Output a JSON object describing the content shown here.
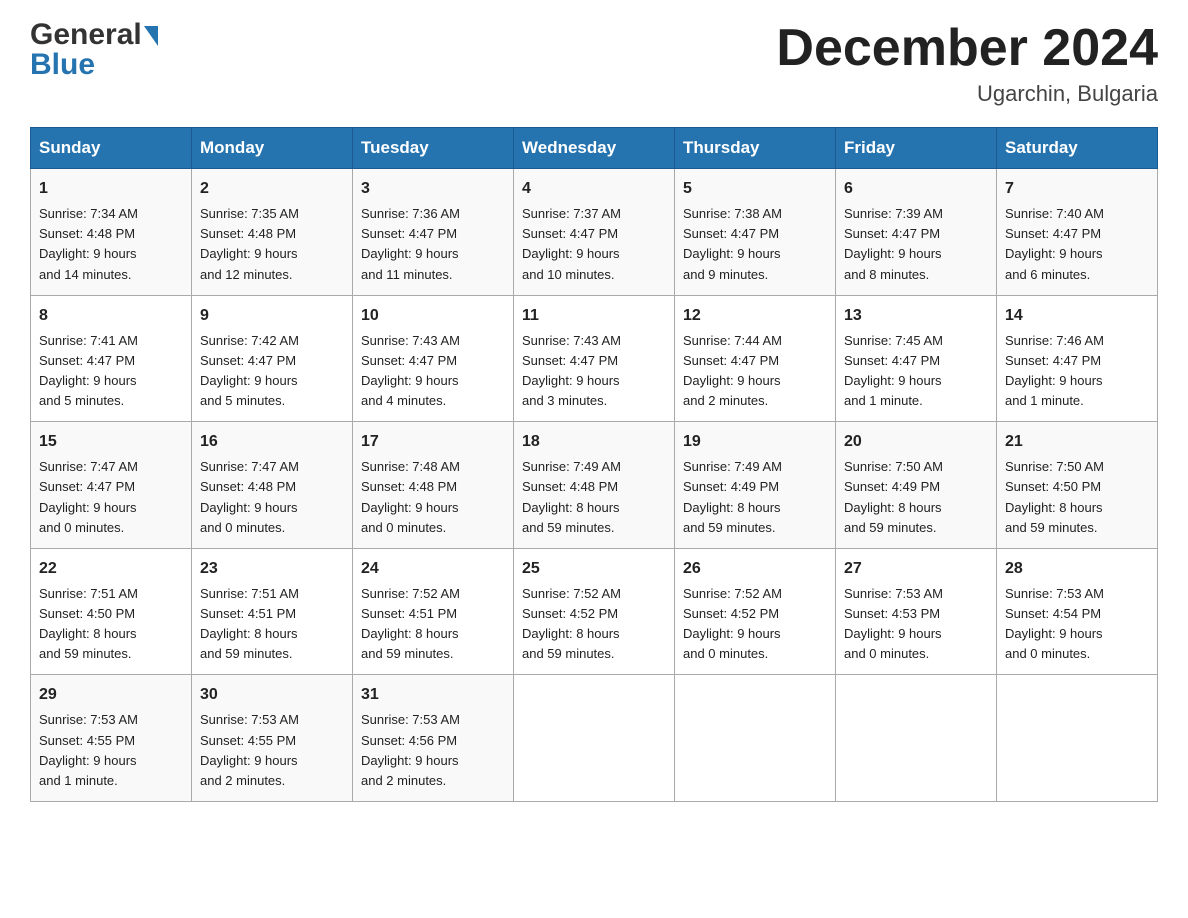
{
  "header": {
    "logo_line1": "General",
    "logo_triangle": "▶",
    "logo_line2": "Blue",
    "month_year": "December 2024",
    "location": "Ugarchin, Bulgaria"
  },
  "columns": [
    "Sunday",
    "Monday",
    "Tuesday",
    "Wednesday",
    "Thursday",
    "Friday",
    "Saturday"
  ],
  "weeks": [
    [
      {
        "day": "1",
        "sunrise": "7:34 AM",
        "sunset": "4:48 PM",
        "daylight": "9 hours and 14 minutes."
      },
      {
        "day": "2",
        "sunrise": "7:35 AM",
        "sunset": "4:48 PM",
        "daylight": "9 hours and 12 minutes."
      },
      {
        "day": "3",
        "sunrise": "7:36 AM",
        "sunset": "4:47 PM",
        "daylight": "9 hours and 11 minutes."
      },
      {
        "day": "4",
        "sunrise": "7:37 AM",
        "sunset": "4:47 PM",
        "daylight": "9 hours and 10 minutes."
      },
      {
        "day": "5",
        "sunrise": "7:38 AM",
        "sunset": "4:47 PM",
        "daylight": "9 hours and 9 minutes."
      },
      {
        "day": "6",
        "sunrise": "7:39 AM",
        "sunset": "4:47 PM",
        "daylight": "9 hours and 8 minutes."
      },
      {
        "day": "7",
        "sunrise": "7:40 AM",
        "sunset": "4:47 PM",
        "daylight": "9 hours and 6 minutes."
      }
    ],
    [
      {
        "day": "8",
        "sunrise": "7:41 AM",
        "sunset": "4:47 PM",
        "daylight": "9 hours and 5 minutes."
      },
      {
        "day": "9",
        "sunrise": "7:42 AM",
        "sunset": "4:47 PM",
        "daylight": "9 hours and 5 minutes."
      },
      {
        "day": "10",
        "sunrise": "7:43 AM",
        "sunset": "4:47 PM",
        "daylight": "9 hours and 4 minutes."
      },
      {
        "day": "11",
        "sunrise": "7:43 AM",
        "sunset": "4:47 PM",
        "daylight": "9 hours and 3 minutes."
      },
      {
        "day": "12",
        "sunrise": "7:44 AM",
        "sunset": "4:47 PM",
        "daylight": "9 hours and 2 minutes."
      },
      {
        "day": "13",
        "sunrise": "7:45 AM",
        "sunset": "4:47 PM",
        "daylight": "9 hours and 1 minute."
      },
      {
        "day": "14",
        "sunrise": "7:46 AM",
        "sunset": "4:47 PM",
        "daylight": "9 hours and 1 minute."
      }
    ],
    [
      {
        "day": "15",
        "sunrise": "7:47 AM",
        "sunset": "4:47 PM",
        "daylight": "9 hours and 0 minutes."
      },
      {
        "day": "16",
        "sunrise": "7:47 AM",
        "sunset": "4:48 PM",
        "daylight": "9 hours and 0 minutes."
      },
      {
        "day": "17",
        "sunrise": "7:48 AM",
        "sunset": "4:48 PM",
        "daylight": "9 hours and 0 minutes."
      },
      {
        "day": "18",
        "sunrise": "7:49 AM",
        "sunset": "4:48 PM",
        "daylight": "8 hours and 59 minutes."
      },
      {
        "day": "19",
        "sunrise": "7:49 AM",
        "sunset": "4:49 PM",
        "daylight": "8 hours and 59 minutes."
      },
      {
        "day": "20",
        "sunrise": "7:50 AM",
        "sunset": "4:49 PM",
        "daylight": "8 hours and 59 minutes."
      },
      {
        "day": "21",
        "sunrise": "7:50 AM",
        "sunset": "4:50 PM",
        "daylight": "8 hours and 59 minutes."
      }
    ],
    [
      {
        "day": "22",
        "sunrise": "7:51 AM",
        "sunset": "4:50 PM",
        "daylight": "8 hours and 59 minutes."
      },
      {
        "day": "23",
        "sunrise": "7:51 AM",
        "sunset": "4:51 PM",
        "daylight": "8 hours and 59 minutes."
      },
      {
        "day": "24",
        "sunrise": "7:52 AM",
        "sunset": "4:51 PM",
        "daylight": "8 hours and 59 minutes."
      },
      {
        "day": "25",
        "sunrise": "7:52 AM",
        "sunset": "4:52 PM",
        "daylight": "8 hours and 59 minutes."
      },
      {
        "day": "26",
        "sunrise": "7:52 AM",
        "sunset": "4:52 PM",
        "daylight": "9 hours and 0 minutes."
      },
      {
        "day": "27",
        "sunrise": "7:53 AM",
        "sunset": "4:53 PM",
        "daylight": "9 hours and 0 minutes."
      },
      {
        "day": "28",
        "sunrise": "7:53 AM",
        "sunset": "4:54 PM",
        "daylight": "9 hours and 0 minutes."
      }
    ],
    [
      {
        "day": "29",
        "sunrise": "7:53 AM",
        "sunset": "4:55 PM",
        "daylight": "9 hours and 1 minute."
      },
      {
        "day": "30",
        "sunrise": "7:53 AM",
        "sunset": "4:55 PM",
        "daylight": "9 hours and 2 minutes."
      },
      {
        "day": "31",
        "sunrise": "7:53 AM",
        "sunset": "4:56 PM",
        "daylight": "9 hours and 2 minutes."
      },
      null,
      null,
      null,
      null
    ]
  ],
  "labels": {
    "sunrise": "Sunrise:",
    "sunset": "Sunset:",
    "daylight": "Daylight:"
  }
}
